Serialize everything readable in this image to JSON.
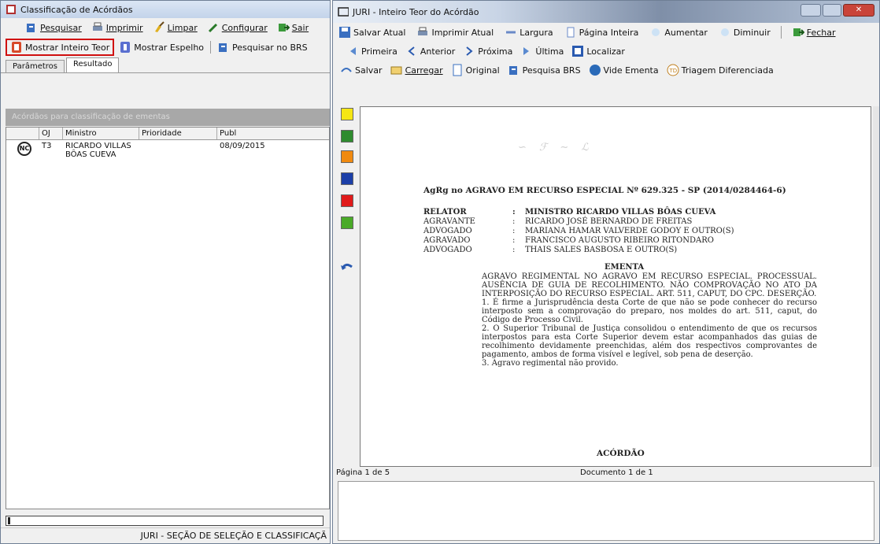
{
  "left_window": {
    "title": "Classificação de Acórdãos",
    "toolbar1": [
      "Pesquisar",
      "Imprimir",
      "Limpar",
      "Configurar",
      "Sair"
    ],
    "toolbar2": [
      "Mostrar Inteiro Teor",
      "Mostrar Espelho",
      "Pesquisar no BRS"
    ],
    "tabs": [
      "Parâmetros",
      "Resultado"
    ],
    "grid_caption": "Acórdãos para classificação de ementas",
    "columns": [
      "OJ",
      "Ministro",
      "Prioridade",
      "Publ"
    ],
    "row": {
      "badge": "NC",
      "oj": "T3",
      "ministro": "RICARDO VILLAS BÔAS CUEVA",
      "prioridade": "",
      "publ": "08/09/2015"
    },
    "status": "JURI - SEÇÃO DE SELEÇÃO E CLASSIFICAÇÃ"
  },
  "right_window": {
    "title": "JURI - Inteiro Teor do Acórdão",
    "toolbar1": [
      "Salvar Atual",
      "Imprimir Atual",
      "Largura",
      "Página Inteira",
      "Aumentar",
      "Diminuir",
      "Fechar"
    ],
    "toolbar2": [
      "Primeira",
      "Anterior",
      "Próxima",
      "Última",
      "Localizar"
    ],
    "toolbar3": [
      "Salvar",
      "Carregar",
      "Original",
      "Pesquisa BRS",
      "Vide Ementa",
      "Triagem Diferenciada"
    ],
    "colors": [
      "#f5e614",
      "#2e8b2e",
      "#f08a10",
      "#1c3fa8",
      "#e01a1a",
      "#4aaa28"
    ],
    "doc": {
      "heading": "AgRg no AGRAVO EM RECURSO ESPECIAL Nº 629.325 - SP (2014/0284464-6)",
      "parties": [
        {
          "role": "RELATOR",
          "name": "MINISTRO RICARDO VILLAS BÔAS CUEVA"
        },
        {
          "role": "AGRAVANTE",
          "name": "RICARDO JOSÉ BERNARDO DE FREITAS"
        },
        {
          "role": "ADVOGADO",
          "name": "MARIANA HAMAR VALVERDE GODOY E OUTRO(S)"
        },
        {
          "role": "AGRAVADO",
          "name": "FRANCISCO AUGUSTO RIBEIRO RITONDARO"
        },
        {
          "role": "ADVOGADO",
          "name": "THAIS SALES BASBOSA E OUTRO(S)"
        }
      ],
      "ementa_title": "EMENTA",
      "ementa_lead": "AGRAVO REGIMENTAL NO AGRAVO EM RECURSO ESPECIAL. PROCESSUAL. AUSÊNCIA DE GUIA DE RECOLHIMENTO. NÃO COMPROVAÇÃO NO ATO DA INTERPOSIÇÃO DO RECURSO ESPECIAL. ART. 511, CAPUT, DO CPC. DESERÇÃO.",
      "item1": "1. É firme a Jurisprudência desta Corte de que não se pode conhecer do recurso interposto sem a comprovação do preparo, nos moldes do art. 511, caput, do Código de Processo Civil.",
      "item2": "2. O Superior Tribunal de Justiça consolidou o entendimento de que os recursos interpostos para esta Corte Superior devem estar acompanhados das guias de recolhimento devidamente preenchidas, além dos respectivos comprovantes de pagamento, ambos de forma visível e legível, sob pena de deserção.",
      "item3": "3. Agravo regimental não provido.",
      "acordao": "ACÓRDÃO"
    },
    "page_info": "Página 1 de 5",
    "doc_info": "Documento 1 de 1"
  }
}
